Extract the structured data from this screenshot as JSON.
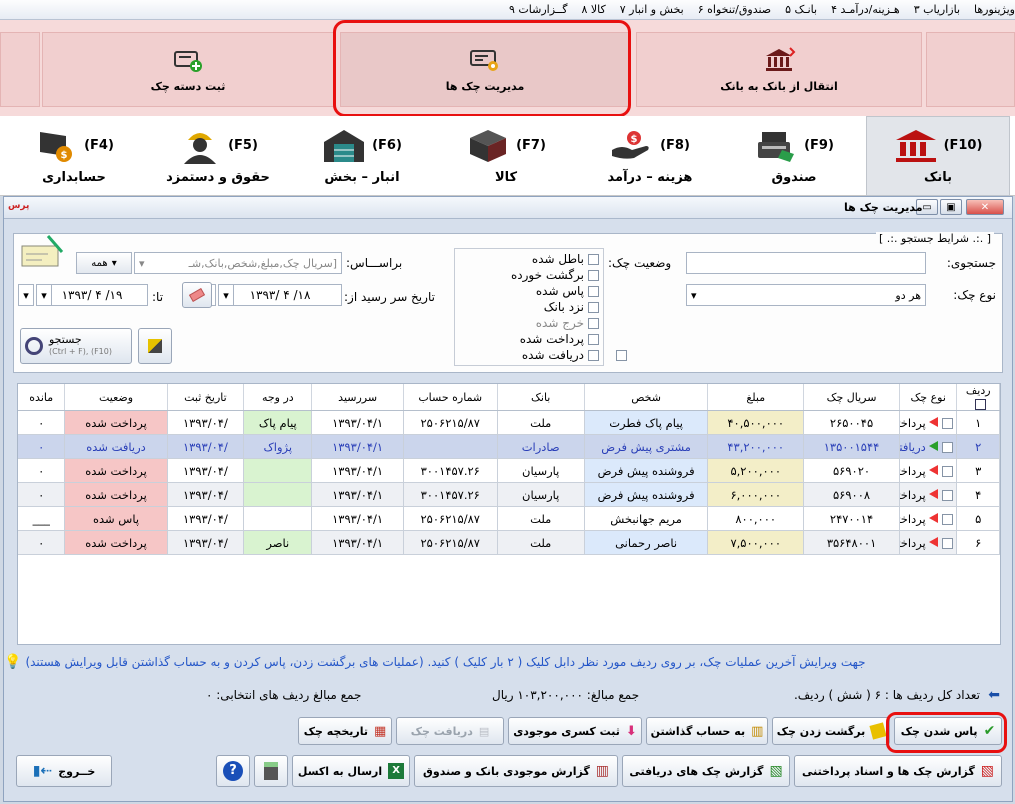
{
  "menubar": {
    "items": [
      "ویژینورها",
      "۳ بازاریاب",
      "۴ هـزینه/درآمـد",
      "۵ بانـک",
      "۶ صندوق/تنخواه",
      "۷ بخش و انبار",
      "۸ کالا",
      "۹ گــزارشات"
    ]
  },
  "ribbon": {
    "buttons": [
      {
        "label": "انتقال از بانک به بانک"
      },
      {
        "label": "مدیریت چک ها"
      },
      {
        "label": "ثبت دسته چک"
      }
    ]
  },
  "tabs": [
    {
      "key": "(F10)",
      "label": "بانک"
    },
    {
      "key": "(F9)",
      "label": "صندوق"
    },
    {
      "key": "(F8)",
      "label": "هزینه – درآمد"
    },
    {
      "key": "(F7)",
      "label": "کالا"
    },
    {
      "key": "(F6)",
      "label": "انبار – بخش"
    },
    {
      "key": "(F5)",
      "label": "حقوق و دستمزد"
    },
    {
      "key": "(F4)",
      "label": "حسابداری"
    }
  ],
  "window": {
    "title": "مدیریت چک ها",
    "app_mark": "پرس"
  },
  "search": {
    "section_title": "[ .:. شرایط جستجو .:. ]",
    "query_label": "جستجوی:",
    "query_value": "",
    "check_type_label": "نوع چک:",
    "check_type_value": "هر دو",
    "status_label": "وضعیت چک:",
    "statuses": [
      "باطل شده",
      "برگشت خورده",
      "پاس شده",
      "نزد بانک",
      "خرج شده",
      "پرداخت شده",
      "دریافت شده"
    ],
    "based_on_label": "براســـاس:",
    "based_on_placeholder": "[سریال چک,مبلغ,شخص,بانک,شـ",
    "all_label": "همه",
    "due_from_label": "تاریخ سر رسید از:",
    "due_from_value": "۱۳۹۳/ ۴ /۱۸",
    "due_to_label": "تا:",
    "due_to_value": "۱۳۹۳/ ۴ /۱۹",
    "search_button": "جستجو",
    "search_shortcut": "(Ctrl + F), (F10)"
  },
  "grid": {
    "columns": [
      "ردیف",
      "نوع چک",
      "سریال چک",
      "مبلغ",
      "شخص",
      "بانک",
      "شماره حساب",
      "سررسید",
      "در وجه",
      "تاریخ ثبت",
      "وضعیت",
      "مانده"
    ],
    "rows": [
      {
        "n": "۱",
        "type": "پرداختی",
        "serial": "۲۶۵۰۰۴۵",
        "amount": "۴۰,۵۰۰,۰۰۰",
        "person": "پیام پاک فطرت",
        "bank": "ملت",
        "account": "۲۵۰۶۲۱۵/۸۷",
        "due": "۱۳۹۳/۰۴/۱",
        "payee": "پیام پاک",
        "reg": "/۱۳۹۳/۰۴",
        "status": "پرداخت شده",
        "rem": "۰"
      },
      {
        "n": "۲",
        "type": "دریافتی",
        "serial": "۱۳۵۰۰۱۵۴۴",
        "amount": "۴۳,۲۰۰,۰۰۰",
        "person": "مشتری پیش فرض",
        "bank": "صادرات",
        "account": "",
        "due": "۱۳۹۳/۰۴/۱",
        "payee": "پژواک",
        "reg": "/۱۳۹۳/۰۴",
        "status": "دریافت شده",
        "rem": "۰"
      },
      {
        "n": "۳",
        "type": "پرداختی",
        "serial": "۵۶۹۰۲۰",
        "amount": "۵,۲۰۰,۰۰۰",
        "person": "فروشنده پیش فرض",
        "bank": "پارسیان",
        "account": "۳۰۰۱۴۵۷.۲۶",
        "due": "۱۳۹۳/۰۴/۱",
        "payee": "",
        "reg": "/۱۳۹۳/۰۴",
        "status": "پرداخت شده",
        "rem": "۰"
      },
      {
        "n": "۴",
        "type": "پرداختی",
        "serial": "۵۶۹۰۰۸",
        "amount": "۶,۰۰۰,۰۰۰",
        "person": "فروشنده پیش فرض",
        "bank": "پارسیان",
        "account": "۳۰۰۱۴۵۷.۲۶",
        "due": "۱۳۹۳/۰۴/۱",
        "payee": "",
        "reg": "/۱۳۹۳/۰۴",
        "status": "پرداخت شده",
        "rem": "۰"
      },
      {
        "n": "۵",
        "type": "پرداختی",
        "serial": "۲۴۷۰۰۱۴",
        "amount": "۸۰۰,۰۰۰",
        "person": "مریم جهانبخش",
        "bank": "ملت",
        "account": "۲۵۰۶۲۱۵/۸۷",
        "due": "۱۳۹۳/۰۴/۱",
        "payee": "",
        "reg": "/۱۳۹۳/۰۴",
        "status": "پاس شده",
        "rem": "___"
      },
      {
        "n": "۶",
        "type": "پرداختی",
        "serial": "۳۵۶۴۸۰۰۱",
        "amount": "۷,۵۰۰,۰۰۰",
        "person": "ناصر رحمانی",
        "bank": "ملت",
        "account": "۲۵۰۶۲۱۵/۸۷",
        "due": "۱۳۹۳/۰۴/۱",
        "payee": "ناصر",
        "reg": "/۱۳۹۳/۰۴",
        "status": "پرداخت شده",
        "rem": "۰"
      }
    ]
  },
  "hint": "جهت ویرایش آخرین عملیات چک، بر روی ردیف مورد نظر دابل کلیک ( ۲ بار کلیک ) کنید. (عملیات های برگشت زدن، پاس کردن و به حساب گذاشتن قابل ویرایش هستند)",
  "totals": {
    "count": "تعداد کل ردیف ها : ۶ ( شش ) ردیف.",
    "sum": "جمع مبالغ: ۱۰۳,۲۰۰,۰۰۰ ریال",
    "sum_selected": "جمع مبالغ ردیف های انتخابی: ۰"
  },
  "actions": {
    "pass": "پاس شدن چک",
    "bounce": "برگشت زدن چک",
    "deposit": "به حساب گذاشتن",
    "deficit": "ثبت کسری موجودی",
    "receive": "دریافت چک",
    "history": "تاریخچه چک"
  },
  "reports": {
    "checks_report": "گزارش چک ها و اسناد پرداختنی",
    "received_report": "گزارش چک های دریافتی",
    "balance_report": "گزارش موجودی بانک و صندوق",
    "excel": "ارسال به اکسل",
    "exit": "خــروج"
  }
}
